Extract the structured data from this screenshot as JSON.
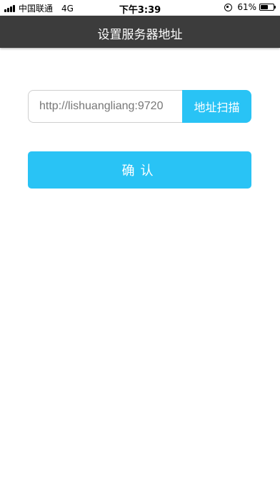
{
  "status_bar": {
    "carrier": "中国联通",
    "network": "4G",
    "time": "下午3:39",
    "battery_percent": "61%",
    "battery_level": 0.61
  },
  "nav": {
    "title": "设置服务器地址"
  },
  "form": {
    "server_url_value": "http://lishuangliang:9720",
    "scan_button_label": "地址扫描",
    "confirm_button_label": "确认"
  },
  "colors": {
    "accent": "#29c3f5",
    "nav_background": "#3c3c3c"
  }
}
